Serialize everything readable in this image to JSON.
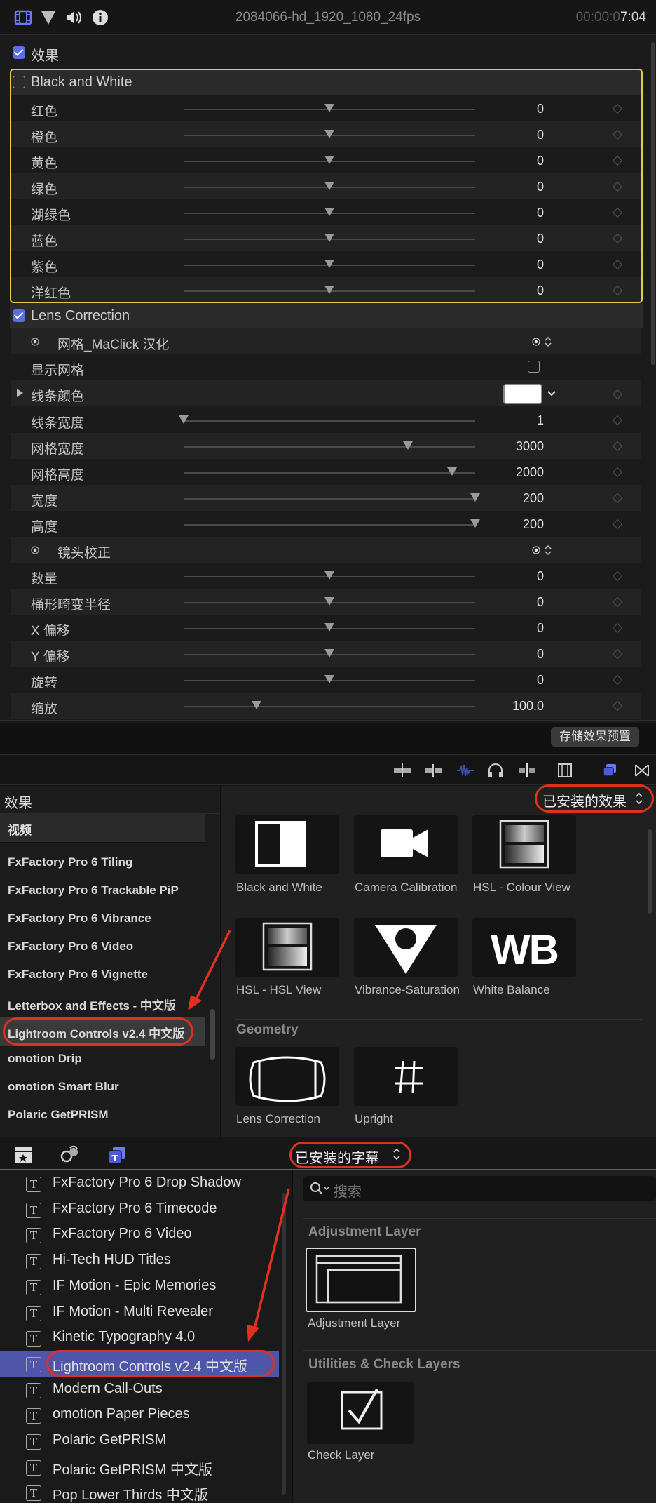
{
  "header": {
    "clip_title": "2084066-hd_1920_1080_24fps",
    "timecode_dim": "00:00:0",
    "timecode_bright": "7:04",
    "icons": [
      "film-icon",
      "filter-icon",
      "audio-icon",
      "info-icon"
    ]
  },
  "effects_section": {
    "label": "效果",
    "checked": true
  },
  "black_white": {
    "name": "Black and White",
    "checked": false,
    "params": [
      {
        "label": "红色",
        "value": "0",
        "level": 0.5
      },
      {
        "label": "橙色",
        "value": "0",
        "level": 0.5
      },
      {
        "label": "黄色",
        "value": "0",
        "level": 0.5
      },
      {
        "label": "绿色",
        "value": "0",
        "level": 0.5
      },
      {
        "label": "湖绿色",
        "value": "0",
        "level": 0.5
      },
      {
        "label": "蓝色",
        "value": "0",
        "level": 0.5
      },
      {
        "label": "紫色",
        "value": "0",
        "level": 0.5
      },
      {
        "label": "洋红色",
        "value": "0",
        "level": 0.5
      }
    ]
  },
  "lens_correction": {
    "name": "Lens Correction",
    "checked": true,
    "grid_group": "网格_MaClick 汉化",
    "show_grid": "显示网格",
    "line_color": "线条颜色",
    "line_color_value": "#ffffff",
    "lens_group": "镜头校正",
    "params": [
      {
        "label": "线条宽度",
        "value": "1",
        "level": 0.0
      },
      {
        "label": "网格宽度",
        "value": "3000",
        "level": 0.77
      },
      {
        "label": "网格高度",
        "value": "2000",
        "level": 0.92
      },
      {
        "label": "宽度",
        "value": "200",
        "level": 1.0
      },
      {
        "label": "高度",
        "value": "200",
        "level": 1.0
      }
    ],
    "lens_params": [
      {
        "label": "数量",
        "value": "0",
        "level": 0.5
      },
      {
        "label": "桶形畸变半径",
        "value": "0",
        "level": 0.5
      },
      {
        "label": "X 偏移",
        "value": "0",
        "level": 0.5
      },
      {
        "label": "Y 偏移",
        "value": "0",
        "level": 0.5
      },
      {
        "label": "旋转",
        "value": "0",
        "level": 0.5
      },
      {
        "label": "缩放",
        "value": "100.0",
        "level": 0.25
      }
    ]
  },
  "save_preset": "存储效果预置",
  "fx_browser": {
    "title": "效果",
    "filter": "已安装的效果",
    "category_header": "视频",
    "items": [
      "FxFactory Pro 6 Tiling",
      "FxFactory Pro 6 Trackable PiP",
      "FxFactory Pro 6 Vibrance",
      "FxFactory Pro 6 Video",
      "FxFactory Pro 6 Vignette",
      "Letterbox and Effects - 中文版",
      "Lightroom Controls v2.4 中文版",
      "omotion Drip",
      "omotion Smart Blur",
      "Polaric GetPRISM"
    ],
    "tiles": [
      {
        "label": "Black and White",
        "icon": "black-white-icon"
      },
      {
        "label": "Camera Calibration",
        "icon": "camera-icon"
      },
      {
        "label": "HSL - Colour View",
        "icon": "hsl-colour-icon"
      },
      {
        "label": "HSL - HSL View",
        "icon": "hsl-view-icon"
      },
      {
        "label": "Vibrance-Saturation",
        "icon": "vibrance-icon"
      },
      {
        "label": "White Balance",
        "icon": "white-balance-icon"
      }
    ],
    "group": "Geometry",
    "geo_tiles": [
      {
        "label": "Lens Correction",
        "icon": "lens-correction-icon"
      },
      {
        "label": "Upright",
        "icon": "upright-icon"
      }
    ]
  },
  "titles_browser": {
    "filter": "已安装的字幕",
    "search_placeholder": "搜索",
    "items": [
      "FxFactory Pro 6 Drop Shadow",
      "FxFactory Pro 6 Timecode",
      "FxFactory Pro 6 Video",
      "Hi-Tech HUD Titles",
      "IF Motion - Epic Memories",
      "IF Motion - Multi Revealer",
      "Kinetic Typography 4.0",
      "Lightroom Controls v2.4 中文版",
      "Modern Call-Outs",
      "omotion Paper Pieces",
      "Polaric GetPRISM",
      "Polaric GetPRISM 中文版",
      "Pop Lower Thirds 中文版"
    ],
    "group1": "Adjustment Layer",
    "tile1": "Adjustment Layer",
    "group2": "Utilities & Check Layers",
    "tile2": "Check Layer"
  },
  "colors": {
    "accent": "#5b6de8",
    "highlight_ring": "#e0301e",
    "selection": "#4f55a8",
    "bw_border": "#e6c94a"
  }
}
